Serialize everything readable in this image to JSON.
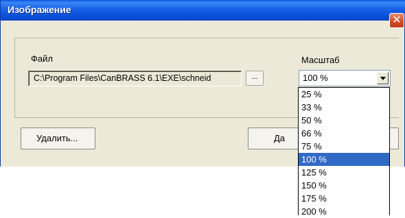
{
  "window": {
    "title": "Изображение",
    "close_symbol": "✕"
  },
  "file": {
    "label": "Файл",
    "path": "C:\\Program Files\\CanBRASS 6.1\\EXE\\schneid",
    "browse_label": "..."
  },
  "scale": {
    "label": "Масштаб",
    "selected": "100 %",
    "options": [
      "25 %",
      "33 %",
      "50 %",
      "66 %",
      "75 %",
      "100 %",
      "125 %",
      "150 %",
      "175 %",
      "200 %"
    ],
    "selected_index": 5
  },
  "buttons": {
    "delete_label": "Удалить...",
    "yes_label": "Да"
  },
  "colors": {
    "titlebar": "#0a55e0",
    "selection": "#316ac5",
    "window_bg": "#ece9d8"
  },
  "icons": {
    "close": "close-icon",
    "dropdown": "chevron-down-icon"
  }
}
